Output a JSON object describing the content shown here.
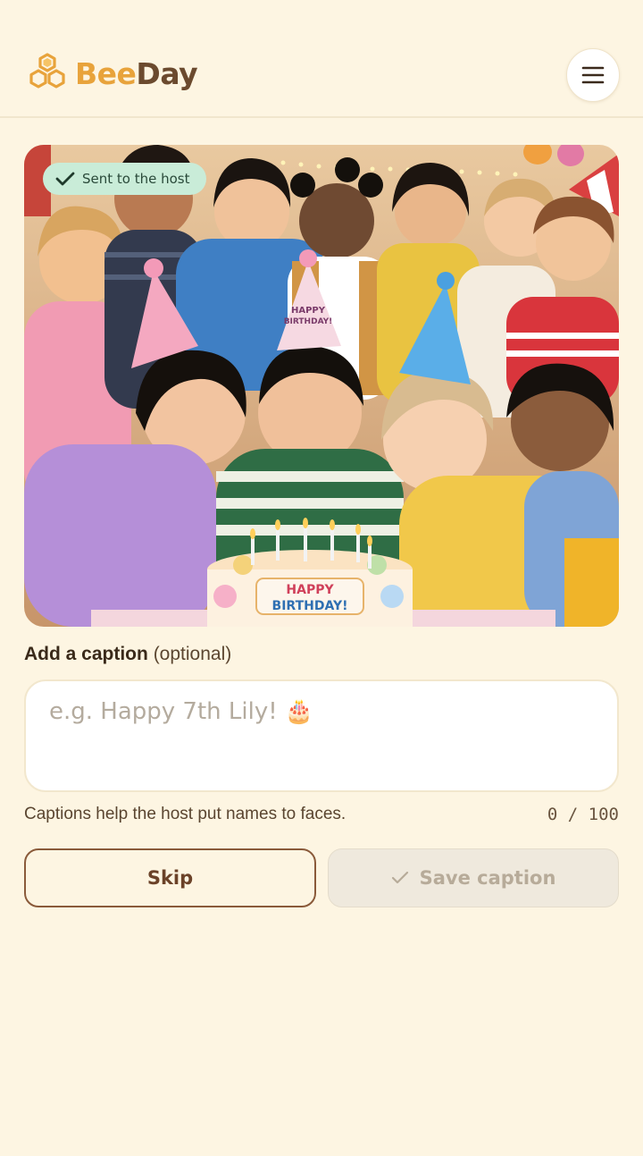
{
  "app": {
    "brand_first": "Bee",
    "brand_second": "Day"
  },
  "photo": {
    "status_badge": "Sent to the host",
    "cake_text_line1": "HAPPY",
    "cake_text_line2": "BIRTHDAY!",
    "hat_text_line1": "HAPPY",
    "hat_text_line2": "BIRTHDAY!"
  },
  "caption": {
    "label_bold": "Add a caption",
    "label_optional": "(optional)",
    "value": "",
    "placeholder": "e.g. Happy 7th Lily! 🎂",
    "hint": "Captions help the host put names to faces.",
    "counter": "0 / 100"
  },
  "actions": {
    "skip_label": "Skip",
    "save_label": "Save caption"
  },
  "colors": {
    "background": "#fdf5e2",
    "brand_gold": "#e8a33b",
    "brand_brown": "#6b4a2e",
    "badge_green": "#c9ecd8"
  },
  "icons": {
    "logo": "honeycomb-icon",
    "menu": "hamburger-menu-icon",
    "badge": "check-icon",
    "save": "check-icon"
  }
}
